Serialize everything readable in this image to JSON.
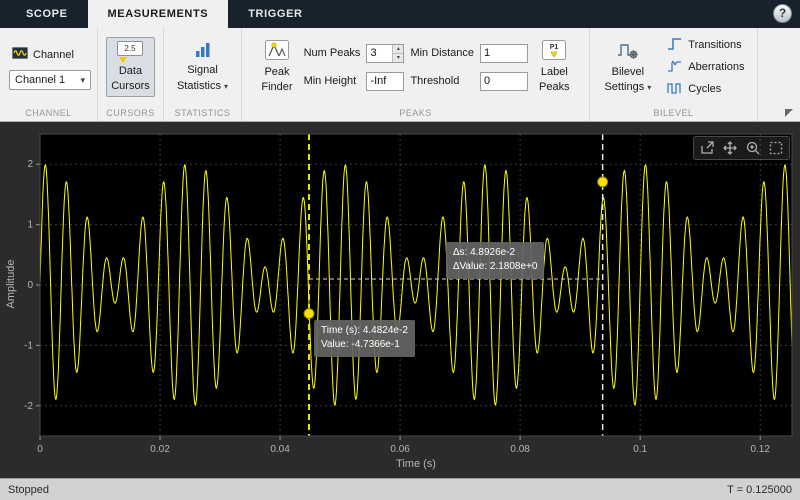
{
  "window": {
    "help_label": "?"
  },
  "tabs": [
    {
      "label": "SCOPE"
    },
    {
      "label": "MEASUREMENTS"
    },
    {
      "label": "TRIGGER"
    }
  ],
  "toolbar": {
    "channel": {
      "section": "CHANNEL",
      "button_label": "Channel",
      "selected_channel": "Channel 1"
    },
    "cursors": {
      "section": "CURSORS",
      "icon_text": "2.5",
      "line1": "Data",
      "line2": "Cursors"
    },
    "statistics": {
      "section": "STATISTICS",
      "line1": "Signal",
      "line2": "Statistics"
    },
    "peaks": {
      "section": "PEAKS",
      "peak_finder_line1": "Peak",
      "peak_finder_line2": "Finder",
      "num_peaks_label": "Num Peaks",
      "num_peaks_value": "3",
      "min_height_label": "Min Height",
      "min_height_value": "-Inf",
      "min_distance_label": "Min Distance",
      "min_distance_value": "1",
      "threshold_label": "Threshold",
      "threshold_value": "0",
      "label_peaks_line1": "Label",
      "label_peaks_line2": "Peaks",
      "label_peaks_icon_text": "P1"
    },
    "bilevel": {
      "section": "BILEVEL",
      "settings_line1": "Bilevel",
      "settings_line2": "Settings",
      "transitions_label": "Transitions",
      "aberrations_label": "Aberrations",
      "cycles_label": "Cycles"
    }
  },
  "plot": {
    "ylabel": "Amplitude",
    "xlabel": "Time (s)",
    "cursor1_time": "Time (s): 4.4824e-2",
    "cursor1_value": "Value: -4.7366e-1",
    "delta_ds": "Δs: 4.8926e-2",
    "delta_dvalue": "ΔValue: 2.1808e+0"
  },
  "status": {
    "left": "Stopped",
    "right": "T = 0.125000"
  },
  "chart_data": {
    "type": "line",
    "title": "",
    "xlabel": "Time (s)",
    "ylabel": "Amplitude",
    "xlim": [
      0,
      0.1253
    ],
    "ylim": [
      -2.5,
      2.5
    ],
    "xticks": [
      0,
      0.02,
      0.04,
      0.06,
      0.08,
      0.1,
      0.12
    ],
    "xtick_labels": [
      "0",
      "0.02",
      "0.04",
      "0.06",
      "0.08",
      "0.1",
      "0.12"
    ],
    "yticks": [
      2,
      1,
      0,
      -1,
      -2
    ],
    "ytick_labels": [
      "2",
      "1",
      "0",
      "-1",
      "-2"
    ],
    "grid": true,
    "series": [
      {
        "name": "Channel 1",
        "color": "#ffff00",
        "synth": {
          "components": [
            {
              "amp": 1.15,
              "freq": 300
            },
            {
              "amp": 0.85,
              "freq": 260
            }
          ],
          "tmax": 0.1253,
          "samples": 2400
        }
      }
    ],
    "cursors": [
      {
        "t": 0.044824,
        "value": -0.47366,
        "style": "yellow-dashed"
      },
      {
        "t": 0.09375,
        "value": 1.7071,
        "style": "white-dashed"
      }
    ],
    "delta": {
      "ds": 0.048926,
      "dvalue": 2.1808,
      "line_value": 0.1
    }
  }
}
